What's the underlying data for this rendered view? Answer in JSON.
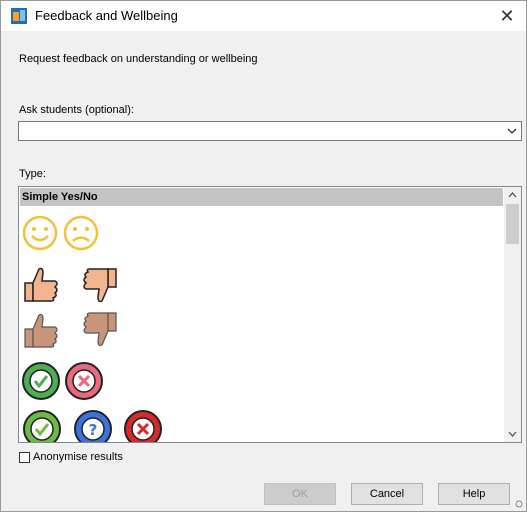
{
  "window": {
    "title": "Feedback and Wellbeing",
    "close_glyph": "✕"
  },
  "intro_text": "Request feedback on understanding or wellbeing",
  "ask": {
    "label": "Ask students (optional):",
    "value": ""
  },
  "type": {
    "label": "Type:",
    "selected_group": "Simple Yes/No",
    "icon_rows": [
      [
        "smiley-happy-icon",
        "smiley-sad-icon"
      ],
      [
        "thumbs-up-light-icon",
        "thumbs-down-light-icon"
      ],
      [
        "thumbs-up-dark-icon",
        "thumbs-down-dark-icon"
      ],
      [
        "check-circle-icon",
        "cross-circle-pink-icon"
      ],
      [
        "check-circle-icon",
        "question-circle-icon",
        "cross-circle-red-icon"
      ]
    ]
  },
  "anonymise": {
    "label": "Anonymise results",
    "checked": false
  },
  "buttons": {
    "ok": "OK",
    "cancel": "Cancel",
    "help": "Help"
  },
  "colors": {
    "smiley": "#f2c23a",
    "thumb_light": "#f1b48c",
    "thumb_dark": "#c8957a",
    "check_green": "#4caf50",
    "cross_pink": "#e86a7c",
    "question_blue": "#3b73d9",
    "cross_red": "#d42a2a"
  }
}
